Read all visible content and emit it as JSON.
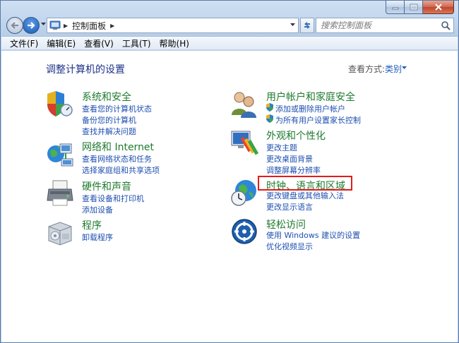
{
  "window": {
    "breadcrumb": "控制面板",
    "search_placeholder": "搜索控制面板"
  },
  "menu": [
    "文件(F)",
    "编辑(E)",
    "查看(V)",
    "工具(T)",
    "帮助(H)"
  ],
  "content": {
    "title": "调整计算机的设置",
    "view_by_label": "查看方式:",
    "view_by_value": "类别"
  },
  "categories": {
    "system": {
      "title": "系统和安全",
      "links": [
        "查看您的计算机状态",
        "备份您的计算机",
        "查找并解决问题"
      ]
    },
    "network": {
      "title": "网络和 Internet",
      "links": [
        "查看网络状态和任务",
        "选择家庭组和共享选项"
      ]
    },
    "hardware": {
      "title": "硬件和声音",
      "links": [
        "查看设备和打印机",
        "添加设备"
      ]
    },
    "programs": {
      "title": "程序",
      "links": [
        "卸载程序"
      ]
    },
    "accounts": {
      "title": "用户帐户和家庭安全",
      "links": [
        "添加或删除用户帐户",
        "为所有用户设置家长控制"
      ]
    },
    "appearance": {
      "title": "外观和个性化",
      "links": [
        "更改主题",
        "更改桌面背景",
        "调整屏幕分辨率"
      ]
    },
    "clock": {
      "title": "时钟、语言和区域",
      "links": [
        "更改键盘或其他输入法",
        "更改显示语言"
      ]
    },
    "ease": {
      "title": "轻松访问",
      "links": [
        "使用 Windows 建议的设置",
        "优化视频显示"
      ]
    }
  },
  "colors": {
    "category_title": "#1e7a2e",
    "link": "#1e4fb0",
    "highlight": "#e21b1b"
  }
}
